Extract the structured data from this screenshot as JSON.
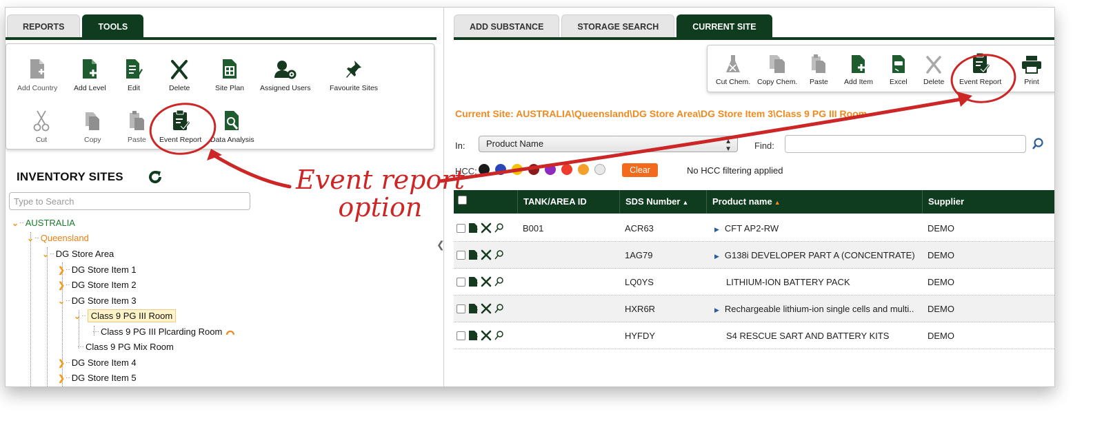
{
  "left_tabs": [
    {
      "label": "REPORTS",
      "active": false
    },
    {
      "label": "TOOLS",
      "active": true
    }
  ],
  "left_tools": {
    "add_country": "Add Country",
    "add_level": "Add Level",
    "edit": "Edit",
    "delete": "Delete",
    "site_plan": "Site Plan",
    "assigned_users": "Assigned Users",
    "favourite_sites": "Favourite Sites",
    "cut": "Cut",
    "copy": "Copy",
    "paste": "Paste",
    "event_report": "Event Report",
    "data_analysis": "Data Analysis"
  },
  "inventory": {
    "title": "INVENTORY SITES",
    "search_placeholder": "Type to Search",
    "tree": {
      "australia": "AUSTRALIA",
      "queensland": "Queensland",
      "dg_store_area": "DG Store Area",
      "dg_item_1": "DG Store Item 1",
      "dg_item_2": "DG Store Item 2",
      "dg_item_3": "DG Store Item 3",
      "class9_room": "Class 9 PG III Room",
      "class9_placarding": "Class 9 PG III Plcarding Room",
      "class9_mix": "Class 9 PG Mix Room",
      "dg_item_4": "DG Store Item 4",
      "dg_item_5": "DG Store Item 5"
    }
  },
  "right_tabs": [
    {
      "label": "ADD SUBSTANCE",
      "active": false
    },
    {
      "label": "STORAGE SEARCH",
      "active": false
    },
    {
      "label": "CURRENT SITE",
      "active": true
    }
  ],
  "right_tools": {
    "cut_chem": "Cut Chem.",
    "copy_chem": "Copy Chem.",
    "paste": "Paste",
    "add_item": "Add Item",
    "excel": "Excel",
    "delete": "Delete",
    "event_report": "Event Report",
    "print": "Print"
  },
  "current_site": "Current Site:  AUSTRALIA\\Queensland\\DG Store Area\\DG Store Item 3\\Class 9 PG III Room",
  "filter": {
    "in_label": "In:",
    "in_value": "Product Name",
    "find_label": "Find:",
    "find_value": "",
    "hcc_label": "HCC:",
    "hcc_colors": [
      "#1a1a1a",
      "#2a45b8",
      "#f5c400",
      "#8b1a1a",
      "#8e2bbf",
      "#ee3b2b",
      "#f5a02a",
      "#e8e8e8"
    ],
    "clear_label": "Clear",
    "hcc_status": "No HCC filtering applied"
  },
  "grid": {
    "columns": [
      "TANK/AREA ID",
      "SDS Number",
      "Product name",
      "Supplier"
    ],
    "rows": [
      {
        "tank": "B001",
        "sds": "ACR63",
        "product": "CFT AP2-RW",
        "supplier": "DEMO",
        "expand": true
      },
      {
        "tank": "",
        "sds": "1AG79",
        "product": "G138i DEVELOPER PART A (CONCENTRATE)",
        "supplier": "DEMO",
        "expand": true
      },
      {
        "tank": "",
        "sds": "LQ0YS",
        "product": "LITHIUM-ION BATTERY PACK",
        "supplier": "DEMO",
        "expand": false
      },
      {
        "tank": "",
        "sds": "HXR6R",
        "product": "Rechargeable lithium-ion single cells and multi..",
        "supplier": "DEMO",
        "expand": true
      },
      {
        "tank": "",
        "sds": "HYFDY",
        "product": "S4 RESCUE SART AND BATTERY KITS",
        "supplier": "DEMO",
        "expand": false
      }
    ]
  },
  "annotation": {
    "line1": "Event report",
    "line2": "option"
  },
  "colors": {
    "brand_dark_green": "#0f3c1e",
    "accent_orange": "#f08a1e",
    "annotation_red": "#cc2626"
  }
}
